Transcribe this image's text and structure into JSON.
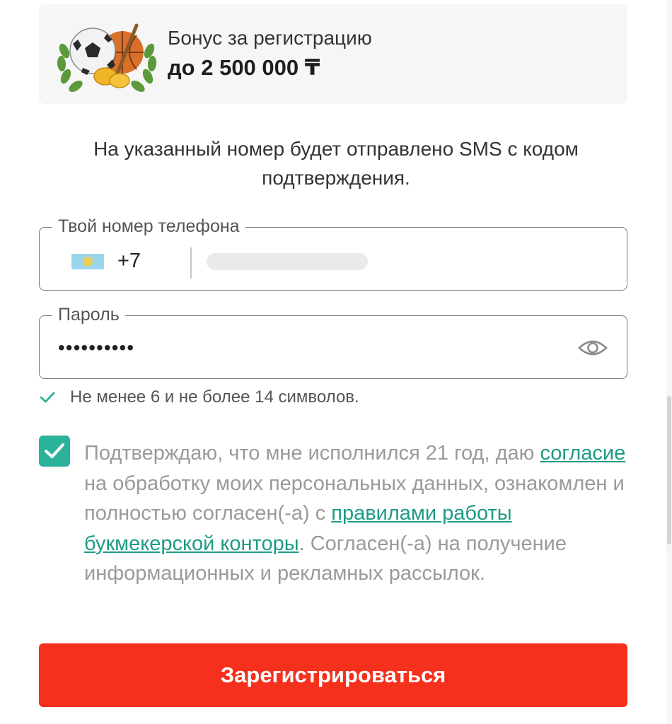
{
  "bonus": {
    "title": "Бонус за регистрацию",
    "amount": "до 2 500 000 ₸"
  },
  "sms_note": "На указанный номер будет отправлено SMS с кодом подтверждения.",
  "phone": {
    "label": "Твой номер телефона",
    "flag_icon": "kazakhstan-flag-icon",
    "dial_code": "+7",
    "value_state": "blurred"
  },
  "password": {
    "label": "Пароль",
    "masked_value": "••••••••••",
    "toggle_icon": "eye-icon"
  },
  "password_hint": {
    "icon": "check-icon",
    "text": "Не менее 6 и не более 14 символов."
  },
  "consent": {
    "checked": true,
    "text_before_link1": "Подтверждаю, что мне исполнился 21 год, даю ",
    "link1": "согласие",
    "text_after_link1": " на обработку моих персональных данных, ознакомлен и полностью согласен(-а) с ",
    "link2": "правилами работы букмекерской конторы",
    "text_after_link2": ". Согласен(-а) на получение информационных и рекламных рассылок."
  },
  "register_button": "Зарегистрироваться",
  "colors": {
    "accent_green": "#2bb39a",
    "link_green": "#1d9b84",
    "button_red": "#f5301d"
  }
}
